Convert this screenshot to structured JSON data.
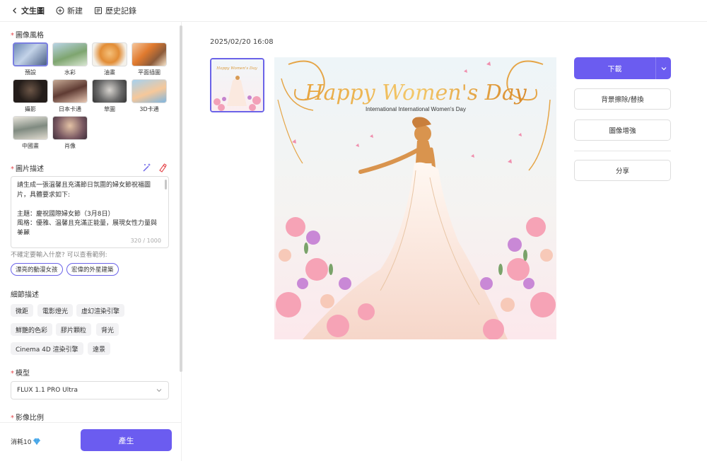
{
  "topbar": {
    "back_label": "文生圖",
    "new_label": "新建",
    "history_label": "歷史記錄"
  },
  "sidebar": {
    "style_section_title": "圖像風格",
    "styles": [
      {
        "label": "預設",
        "selected": true
      },
      {
        "label": "水彩"
      },
      {
        "label": "油畫"
      },
      {
        "label": "平面插圖"
      },
      {
        "label": "攝影"
      },
      {
        "label": "日本卡通"
      },
      {
        "label": "草圖"
      },
      {
        "label": "3D卡通"
      },
      {
        "label": "中國畫"
      },
      {
        "label": "肖像"
      }
    ],
    "description_title": "圖片描述",
    "description_text": "請生成一張溫馨且充滿節日氛圍的婦女節祝福圖片，具體要求如下:\n\n主題：慶祝國際婦女節（3月8日）\n風格：優雅、溫馨且充滿正能量，展現女性力量與美麗",
    "description_count": "320 / 1000",
    "hint_text": "不確定要輸入什麼? 可以查看範例:",
    "example_chips": [
      "漂亮的動漫女孩",
      "宏偉的外星建築"
    ],
    "detail_title": "細節描述",
    "detail_chips": [
      "微距",
      "電影燈光",
      "虛幻渲染引擎",
      "鮮艷的色彩",
      "膠片顆粒",
      "背光",
      "Cinema 4D 渲染引擎",
      "遠景"
    ],
    "model_title": "模型",
    "model_value": "FLUX 1.1 PRO Ultra",
    "ratio_title": "影像比例",
    "cost_label": "消耗10",
    "generate_label": "產生"
  },
  "main": {
    "timestamp": "2025/02/20 16:08",
    "image_title": "Happy Women's Day",
    "image_subtitle": "International International Women's Day",
    "thumb_title": "Happy Women's Day"
  },
  "actions": {
    "download_label": "下載",
    "bg_label": "背景擦除/替換",
    "enhance_label": "圖像增強",
    "share_label": "分享"
  },
  "colors": {
    "accent": "#6b5cf0",
    "required": "#e5484d"
  }
}
